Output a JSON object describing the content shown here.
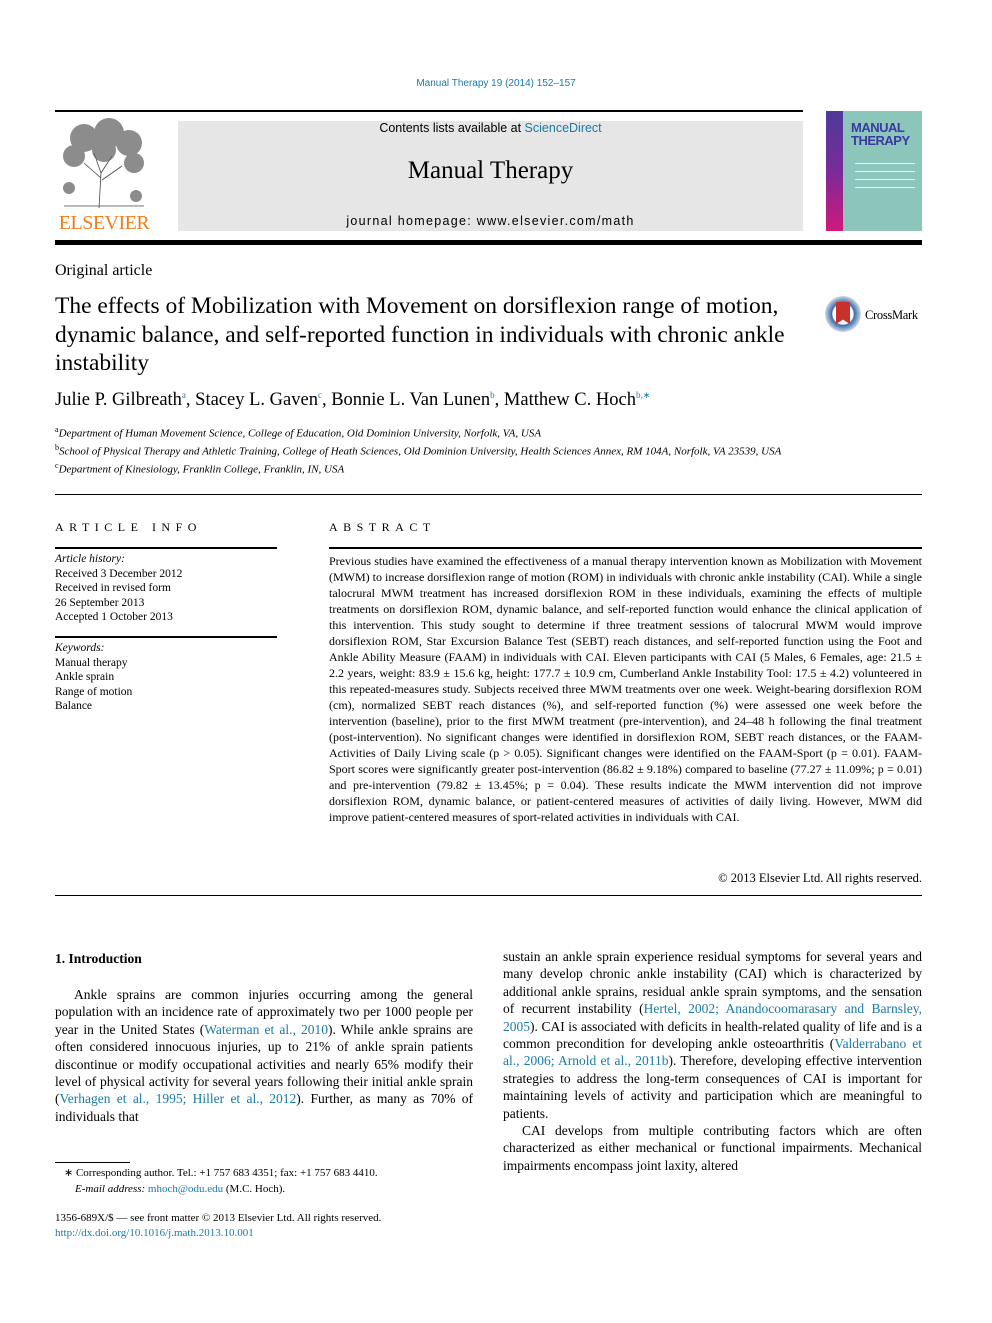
{
  "journal_citation": "Manual Therapy 19 (2014) 152–157",
  "header": {
    "publisher_logo_text": "ELSEVIER",
    "contents_prefix": "Contents lists available at ",
    "contents_link": "ScienceDirect",
    "journal_name": "Manual Therapy",
    "homepage": "journal homepage: www.elsevier.com/math",
    "cover_title_line1": "MANUAL",
    "cover_title_line2": "THERAPY"
  },
  "article": {
    "type": "Original article",
    "title": "The effects of Mobilization with Movement on dorsiflexion range of motion, dynamic balance, and self-reported function in individuals with chronic ankle instability",
    "crossmark_label": "CrossMark",
    "authors": [
      {
        "name": "Julie P. Gilbreath",
        "sup": "a",
        "sep": ", "
      },
      {
        "name": "Stacey L. Gaven",
        "sup": "c",
        "sep": ", "
      },
      {
        "name": "Bonnie L. Van Lunen",
        "sup": "b",
        "sep": ", "
      },
      {
        "name": "Matthew C. Hoch",
        "sup": "b,∗",
        "sep": ""
      }
    ],
    "affiliations": [
      {
        "sup": "a",
        "text": "Department of Human Movement Science, College of Education, Old Dominion University, Norfolk, VA, USA"
      },
      {
        "sup": "b",
        "text": "School of Physical Therapy and Athletic Training, College of Heath Sciences, Old Dominion University, Health Sciences Annex, RM 104A, Norfolk, VA 23539, USA"
      },
      {
        "sup": "c",
        "text": "Department of Kinesiology, Franklin College, Franklin, IN, USA"
      }
    ]
  },
  "article_info": {
    "heading": "ARTICLE INFO",
    "history_label": "Article history:",
    "history": [
      "Received 3 December 2012",
      "Received in revised form",
      "26 September 2013",
      "Accepted 1 October 2013"
    ],
    "keywords_label": "Keywords:",
    "keywords": [
      "Manual therapy",
      "Ankle sprain",
      "Range of motion",
      "Balance"
    ]
  },
  "abstract": {
    "heading": "ABSTRACT",
    "text": "Previous studies have examined the effectiveness of a manual therapy intervention known as Mobilization with Movement (MWM) to increase dorsiflexion range of motion (ROM) in individuals with chronic ankle instability (CAI). While a single talocrural MWM treatment has increased dorsiflexion ROM in these individuals, examining the effects of multiple treatments on dorsiflexion ROM, dynamic balance, and self-reported function would enhance the clinical application of this intervention. This study sought to determine if three treatment sessions of talocrural MWM would improve dorsiflexion ROM, Star Excursion Balance Test (SEBT) reach distances, and self-reported function using the Foot and Ankle Ability Measure (FAAM) in individuals with CAI. Eleven participants with CAI (5 Males, 6 Females, age: 21.5 ± 2.2 years, weight: 83.9 ± 15.6 kg, height: 177.7 ± 10.9 cm, Cumberland Ankle Instability Tool: 17.5 ± 4.2) volunteered in this repeated-measures study. Subjects received three MWM treatments over one week. Weight-bearing dorsiflexion ROM (cm), normalized SEBT reach distances (%), and self-reported function (%) were assessed one week before the intervention (baseline), prior to the first MWM treatment (pre-intervention), and 24–48 h following the final treatment (post-intervention). No significant changes were identified in dorsiflexion ROM, SEBT reach distances, or the FAAM-Activities of Daily Living scale (p > 0.05). Significant changes were identified on the FAAM-Sport (p = 0.01). FAAM-Sport scores were significantly greater post-intervention (86.82 ± 9.18%) compared to baseline (77.27 ± 11.09%; p = 0.01) and pre-intervention (79.82 ± 13.45%; p = 0.04). These results indicate the MWM intervention did not improve dorsiflexion ROM, dynamic balance, or patient-centered measures of activities of daily living. However, MWM did improve patient-centered measures of sport-related activities in individuals with CAI.",
    "copyright": "© 2013 Elsevier Ltd. All rights reserved."
  },
  "introduction": {
    "heading": "1. Introduction",
    "left_p1": [
      {
        "t": "Ankle sprains are common injuries occurring among the general population with an incidence rate of approximately two per 1000 people per year in the United States ("
      },
      {
        "t": "Waterman et al., 2010",
        "link": true
      },
      {
        "t": "). While ankle sprains are often considered innocuous injuries, up to 21% of ankle sprain patients discontinue or modify occupational activities and nearly 65% modify their level of physical activity for several years following their initial ankle sprain ("
      },
      {
        "t": "Verhagen et al., 1995; Hiller et al., 2012",
        "link": true
      },
      {
        "t": "). Further, as many as 70% of individuals that"
      }
    ],
    "right_p1": [
      {
        "t": "sustain an ankle sprain experience residual symptoms for several years and many develop chronic ankle instability (CAI) which is characterized by additional ankle sprains, residual ankle sprain symptoms, and the sensation of recurrent instability ("
      },
      {
        "t": "Hertel, 2002; Anandocoomarasary and Barnsley, 2005",
        "link": true
      },
      {
        "t": "). CAI is associated with deficits in health-related quality of life and is a common precondition for developing ankle osteoarthritis ("
      },
      {
        "t": "Valderrabano et al., 2006; Arnold et al., 2011b",
        "link": true
      },
      {
        "t": "). Therefore, developing effective intervention strategies to address the long-term consequences of CAI is important for maintaining levels of activity and participation which are meaningful to patients."
      }
    ],
    "right_p2": "CAI develops from multiple contributing factors which are often characterized as either mechanical or functional impairments. Mechanical impairments encompass joint laxity, altered"
  },
  "footnote": {
    "marker": "∗",
    "corresponding": "Corresponding author. Tel.: +1 757 683 4351; fax: +1 757 683 4410.",
    "email_label": "E-mail address:",
    "email": "mhoch@odu.edu",
    "email_suffix": " (M.C. Hoch)."
  },
  "front_matter": {
    "issn_line": "1356-689X/$ — see front matter © 2013 Elsevier Ltd. All rights reserved.",
    "doi": "http://dx.doi.org/10.1016/j.math.2013.10.001"
  }
}
